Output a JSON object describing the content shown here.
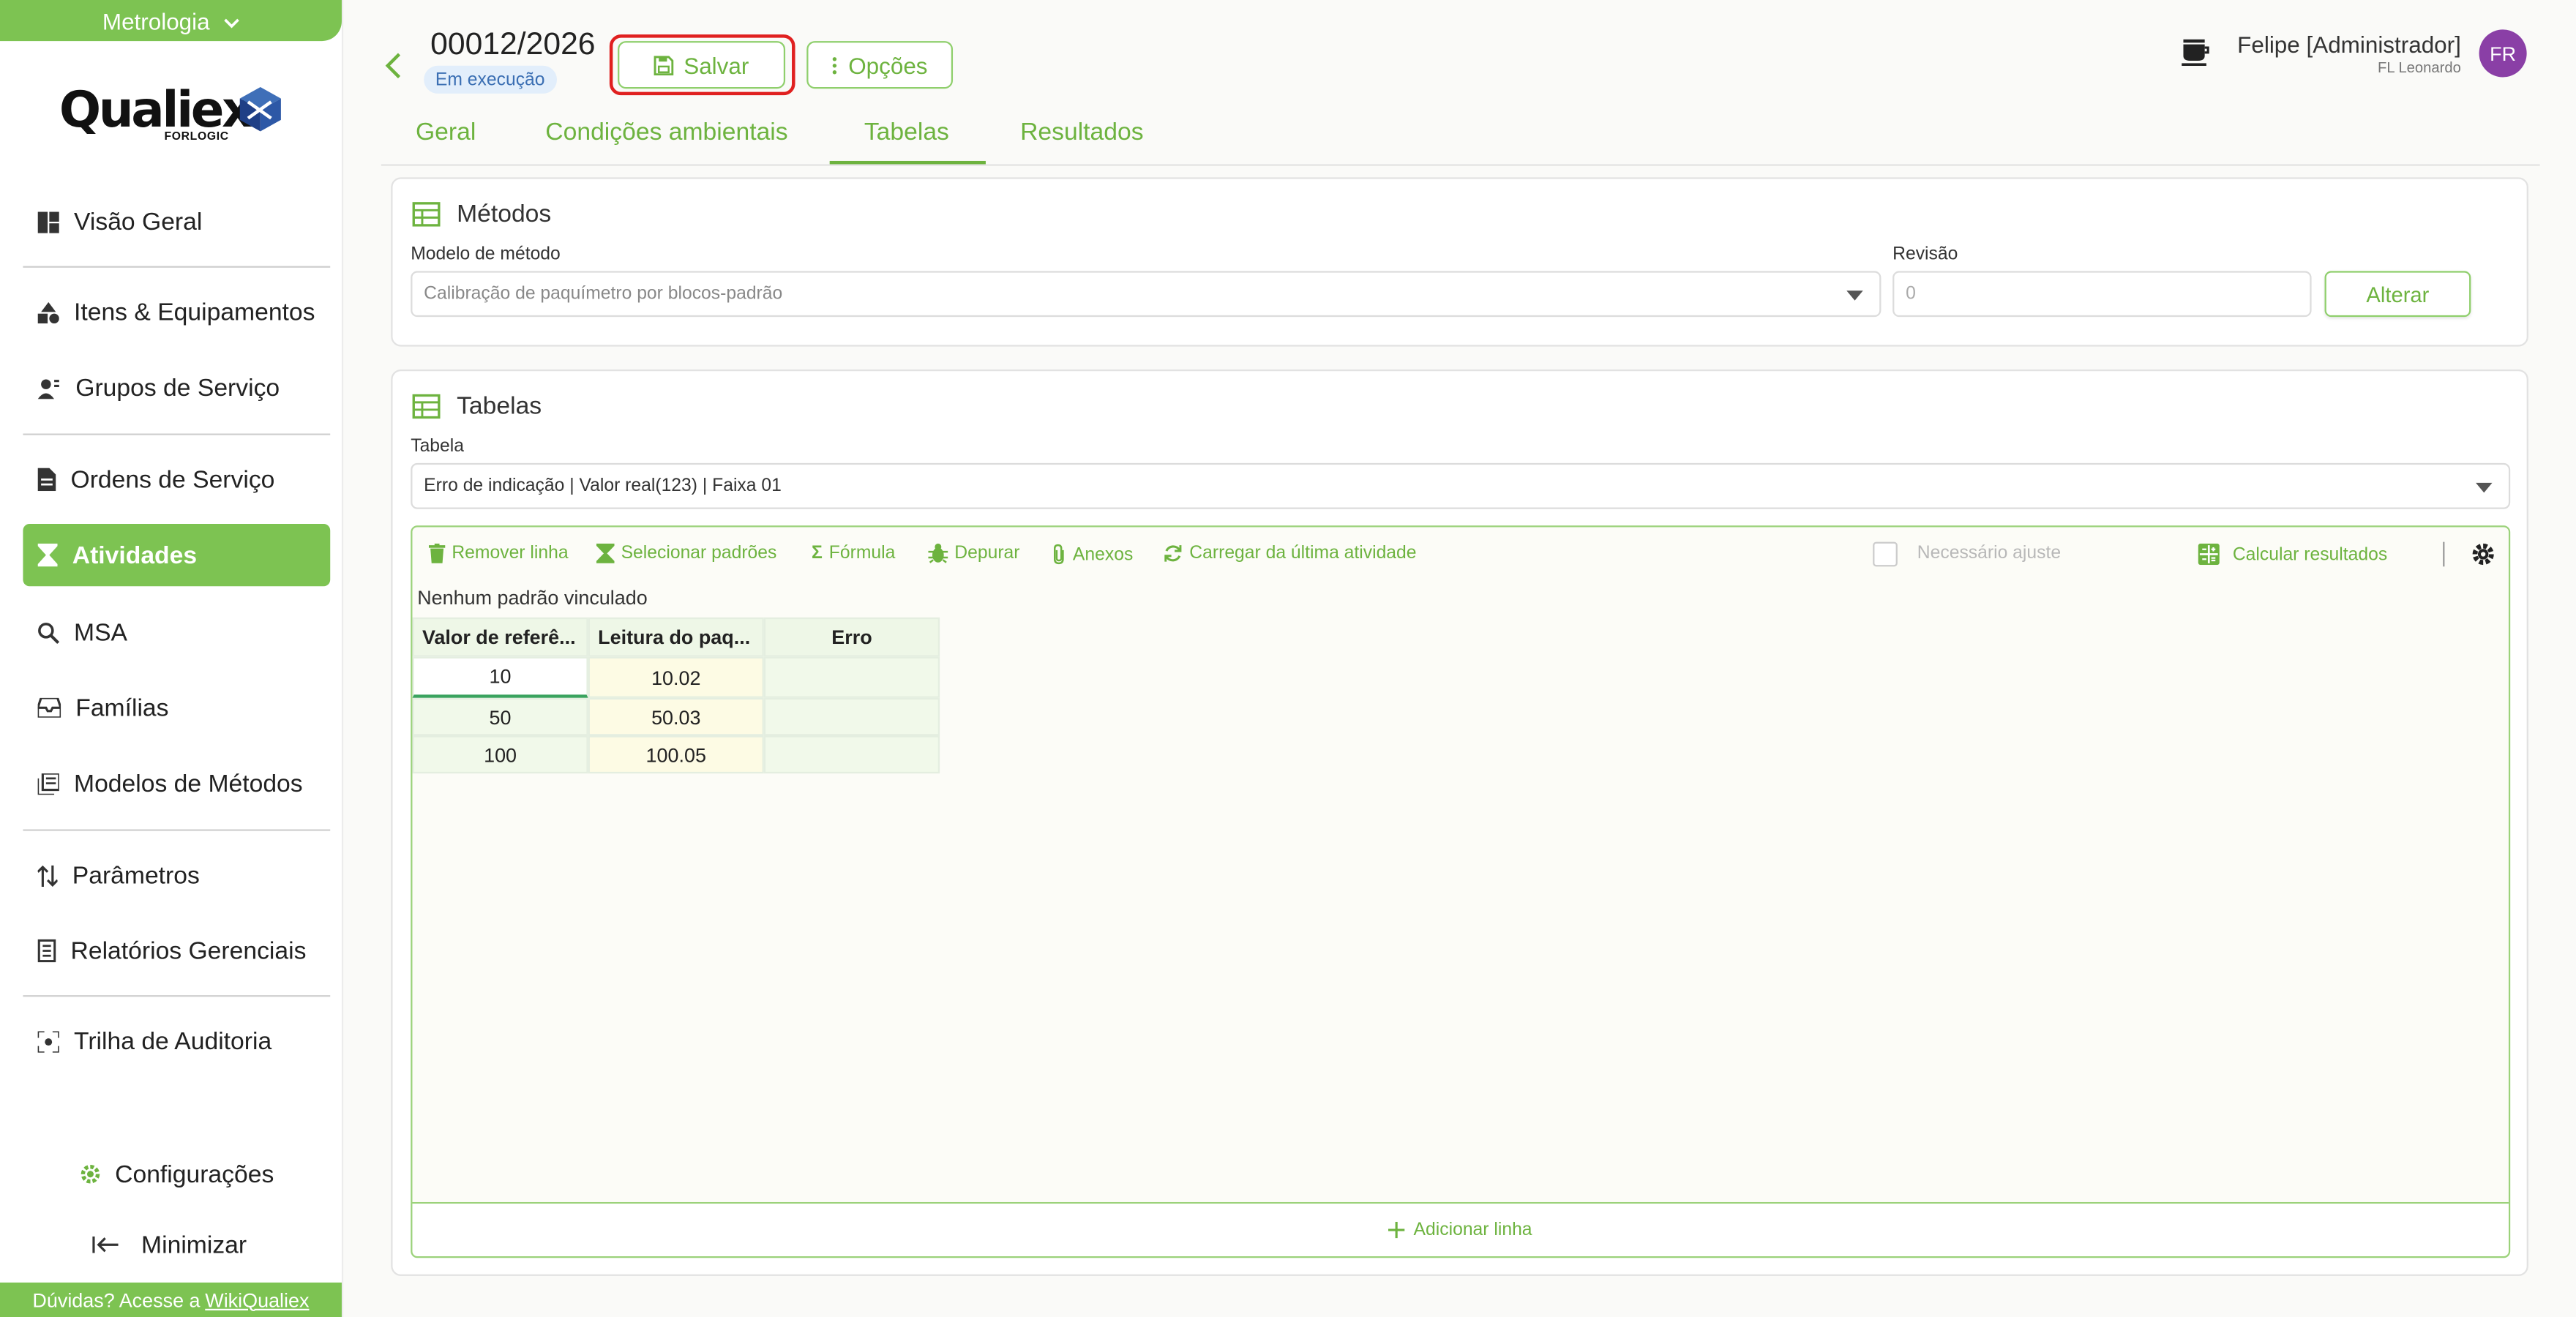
{
  "sidebar": {
    "module_label": "Metrologia",
    "logo_text": "Qualiex",
    "logo_sub": "FORLOGIC",
    "items": [
      {
        "label": "Visão Geral"
      },
      {
        "label": "Itens & Equipamentos"
      },
      {
        "label": "Grupos de Serviço"
      },
      {
        "label": "Ordens de Serviço"
      },
      {
        "label": "Atividades"
      },
      {
        "label": "MSA"
      },
      {
        "label": "Famílias"
      },
      {
        "label": "Modelos de Métodos"
      },
      {
        "label": "Parâmetros"
      },
      {
        "label": "Relatórios Gerenciais"
      },
      {
        "label": "Trilha de Auditoria"
      }
    ],
    "settings_label": "Configurações",
    "minimize_label": "Minimizar",
    "help_text": "Dúvidas? Acesse a",
    "help_link": "WikiQualiex"
  },
  "header": {
    "code": "00012/2026",
    "status": "Em execução",
    "save_label": "Salvar",
    "options_label": "Opções",
    "user_name": "Felipe [Administrador]",
    "user_company": "FL Leonardo",
    "avatar_initials": "FR"
  },
  "tabs": [
    "Geral",
    "Condições ambientais",
    "Tabelas",
    "Resultados"
  ],
  "active_tab": "Tabelas",
  "methods": {
    "title": "Métodos",
    "model_label": "Modelo de método",
    "model_value": "Calibração de paquímetro por blocos-padrão",
    "revision_label": "Revisão",
    "revision_placeholder": "0",
    "change_label": "Alterar"
  },
  "tables": {
    "title": "Tabelas",
    "table_label": "Tabela",
    "table_value": "Erro de indicação | Valor real(123) | Faixa 01",
    "toolbar": {
      "remove_row": "Remover linha",
      "select_standards": "Selecionar padrões",
      "formula": "Fórmula",
      "debug": "Depurar",
      "attachments": "Anexos",
      "load_last": "Carregar da última atividade",
      "adjust_required": "Necessário ajuste",
      "calc_results": "Calcular resultados"
    },
    "no_standard": "Nenhum padrão vinculado",
    "columns": [
      "Valor de referê...",
      "Leitura do paq...",
      "Erro"
    ],
    "rows": [
      [
        "10",
        "10.02",
        ""
      ],
      [
        "50",
        "50.03",
        ""
      ],
      [
        "100",
        "100.05",
        ""
      ]
    ],
    "add_row": "Adicionar linha"
  },
  "colors": {
    "accent": "#7dc352",
    "highlight": "#e02020",
    "avatar": "#8a3fa6"
  }
}
